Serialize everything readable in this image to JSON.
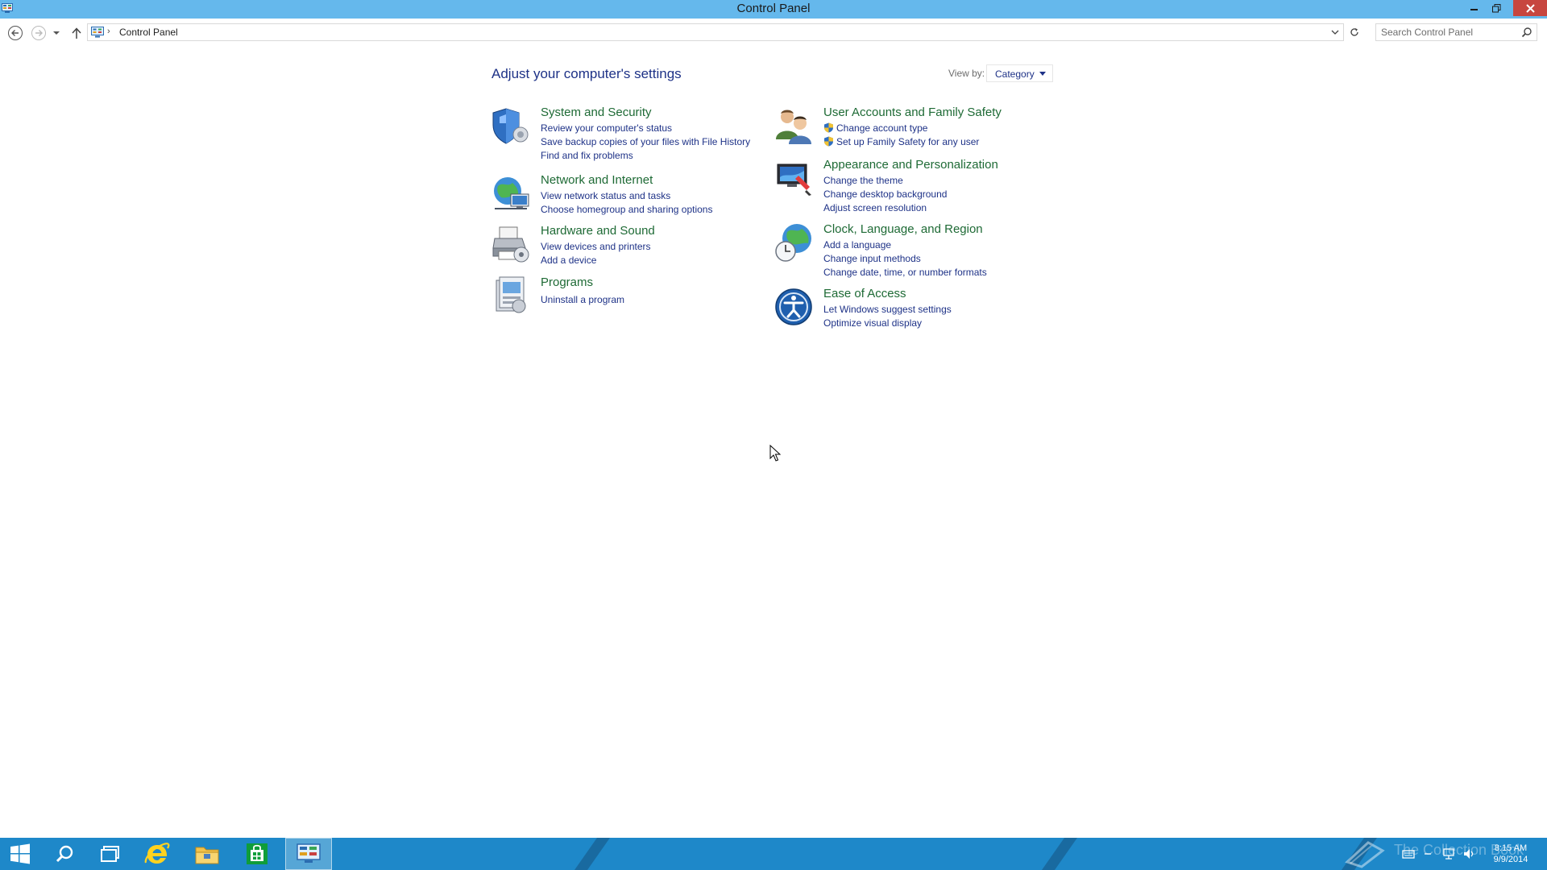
{
  "window": {
    "title": "Control Panel",
    "minimize_icon": "minimize-icon",
    "maximize_icon": "restore-icon",
    "close_icon": "close-icon",
    "title_bar_color": "#65b8ec",
    "close_color": "#c7463f"
  },
  "navigation": {
    "back_icon": "back-arrow-icon",
    "forward_icon": "forward-arrow-icon",
    "recent_icon": "chevron-down-icon",
    "up_icon": "up-arrow-icon",
    "breadcrumb": [
      "Control Panel"
    ],
    "search_placeholder": "Search Control Panel"
  },
  "content": {
    "heading": "Adjust your computer's settings",
    "view_by_label": "View by:",
    "view_by_value": "Category",
    "link_color": "#1e3287",
    "title_color": "#1e6a35",
    "categories": [
      {
        "title": "System and Security",
        "icon": "shield-icon",
        "links": [
          "Review your computer's status",
          "Save backup copies of your files with File History",
          "Find and fix problems"
        ]
      },
      {
        "title": "Network and Internet",
        "icon": "network-globe-icon",
        "links": [
          "View network status and tasks",
          "Choose homegroup and sharing options"
        ]
      },
      {
        "title": "Hardware and Sound",
        "icon": "printer-icon",
        "links": [
          "View devices and printers",
          "Add a device"
        ]
      },
      {
        "title": "Programs",
        "icon": "programs-icon",
        "links": [
          "Uninstall a program"
        ]
      },
      {
        "title": "User Accounts and Family Safety",
        "icon": "users-icon",
        "links": [
          "Change account type",
          "Set up Family Safety for any user"
        ]
      },
      {
        "title": "Appearance and Personalization",
        "icon": "monitor-paint-icon",
        "links": [
          "Change the theme",
          "Change desktop background",
          "Adjust screen resolution"
        ]
      },
      {
        "title": "Clock, Language, and Region",
        "icon": "clock-globe-icon",
        "links": [
          "Add a language",
          "Change input methods",
          "Change date, time, or number formats"
        ]
      },
      {
        "title": "Ease of Access",
        "icon": "ease-of-access-icon",
        "links": [
          "Let Windows suggest settings",
          "Optimize visual display"
        ]
      }
    ]
  },
  "taskbar": {
    "items": [
      "start-icon",
      "search-icon",
      "task-view-icon",
      "internet-explorer-icon",
      "file-explorer-icon",
      "store-icon",
      "control-panel-icon"
    ],
    "watermark": "The Collection Book",
    "clock_time": "8:15 AM",
    "clock_date": "9/9/2014",
    "color": "#1e88c9"
  }
}
